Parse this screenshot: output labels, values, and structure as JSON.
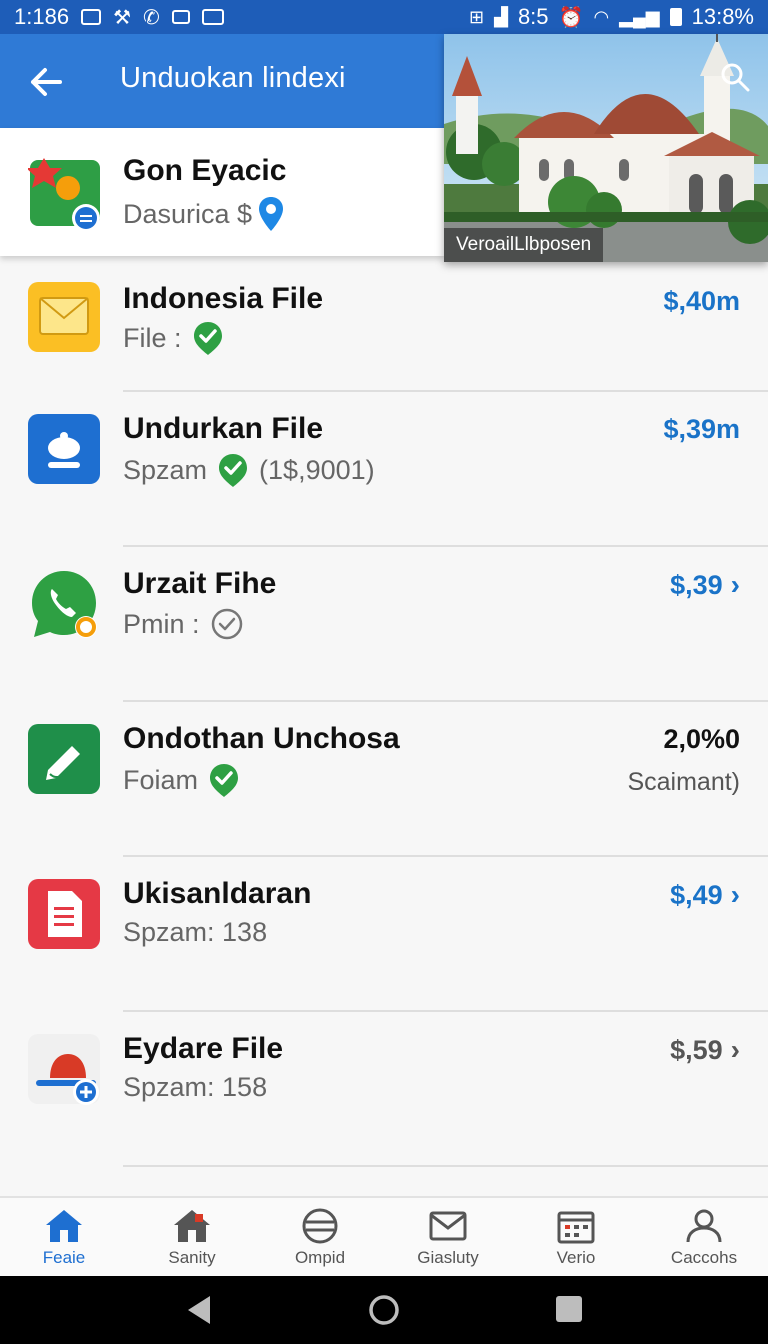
{
  "status_bar": {
    "time": "1:186",
    "icons_left": [
      "square-icon",
      "wrench-icon",
      "phone-icon",
      "tv-icon",
      "photo-icon"
    ],
    "signal_text": "8:5",
    "right_letters": "ꟾ",
    "battery": "13:8%"
  },
  "app_bar": {
    "title": "Unduokan lindexi"
  },
  "top_card": {
    "title": "Gon Eyacic",
    "subtitle": "Dasurica $"
  },
  "photo": {
    "caption": "VeroailLlbposen"
  },
  "list": [
    {
      "title": "Indonesia File",
      "subtitle": "File :",
      "badge": "check",
      "price": "$,40m",
      "price_style": "blue",
      "chevron": false,
      "price_sub": ""
    },
    {
      "title": "Undurkan File",
      "subtitle": "Spzam",
      "badge": "check",
      "extra": "(1$,9001)",
      "price": "$,39m",
      "price_style": "blue",
      "chevron": false,
      "price_sub": ""
    },
    {
      "title": "Urzait Fihe",
      "subtitle": "Pmin :",
      "badge": "outline-check",
      "price": "$,39",
      "price_style": "blue",
      "chevron": true,
      "price_sub": ""
    },
    {
      "title": "Ondothan Unchosa",
      "subtitle": "Foiam",
      "badge": "check",
      "price": "2,0%0",
      "price_style": "dark",
      "chevron": false,
      "price_sub": "Scaimant)"
    },
    {
      "title": "Ukisanldaran",
      "subtitle": "Spzam: 138",
      "badge": "none",
      "price": "$,49",
      "price_style": "blue",
      "chevron": true,
      "price_sub": ""
    },
    {
      "title": "Eydare File",
      "subtitle": "Spzam: 158",
      "badge": "none",
      "price": "$,59",
      "price_style": "gray",
      "chevron": true,
      "price_sub": ""
    }
  ],
  "bottom_nav": [
    {
      "label": "Feaie",
      "icon": "home-icon",
      "active": true
    },
    {
      "label": "Sanity",
      "icon": "house-icon",
      "active": false
    },
    {
      "label": "Ompid",
      "icon": "globe-icon",
      "active": false
    },
    {
      "label": "Giasluty",
      "icon": "mail-icon",
      "active": false
    },
    {
      "label": "Verio",
      "icon": "calendar-icon",
      "active": false
    },
    {
      "label": "Caccohs",
      "icon": "person-icon",
      "active": false
    }
  ],
  "colors": {
    "primary": "#2f7ad6",
    "status_bar": "#1e5db8",
    "price_blue": "#1a73c8",
    "check_green": "#2ea043"
  }
}
